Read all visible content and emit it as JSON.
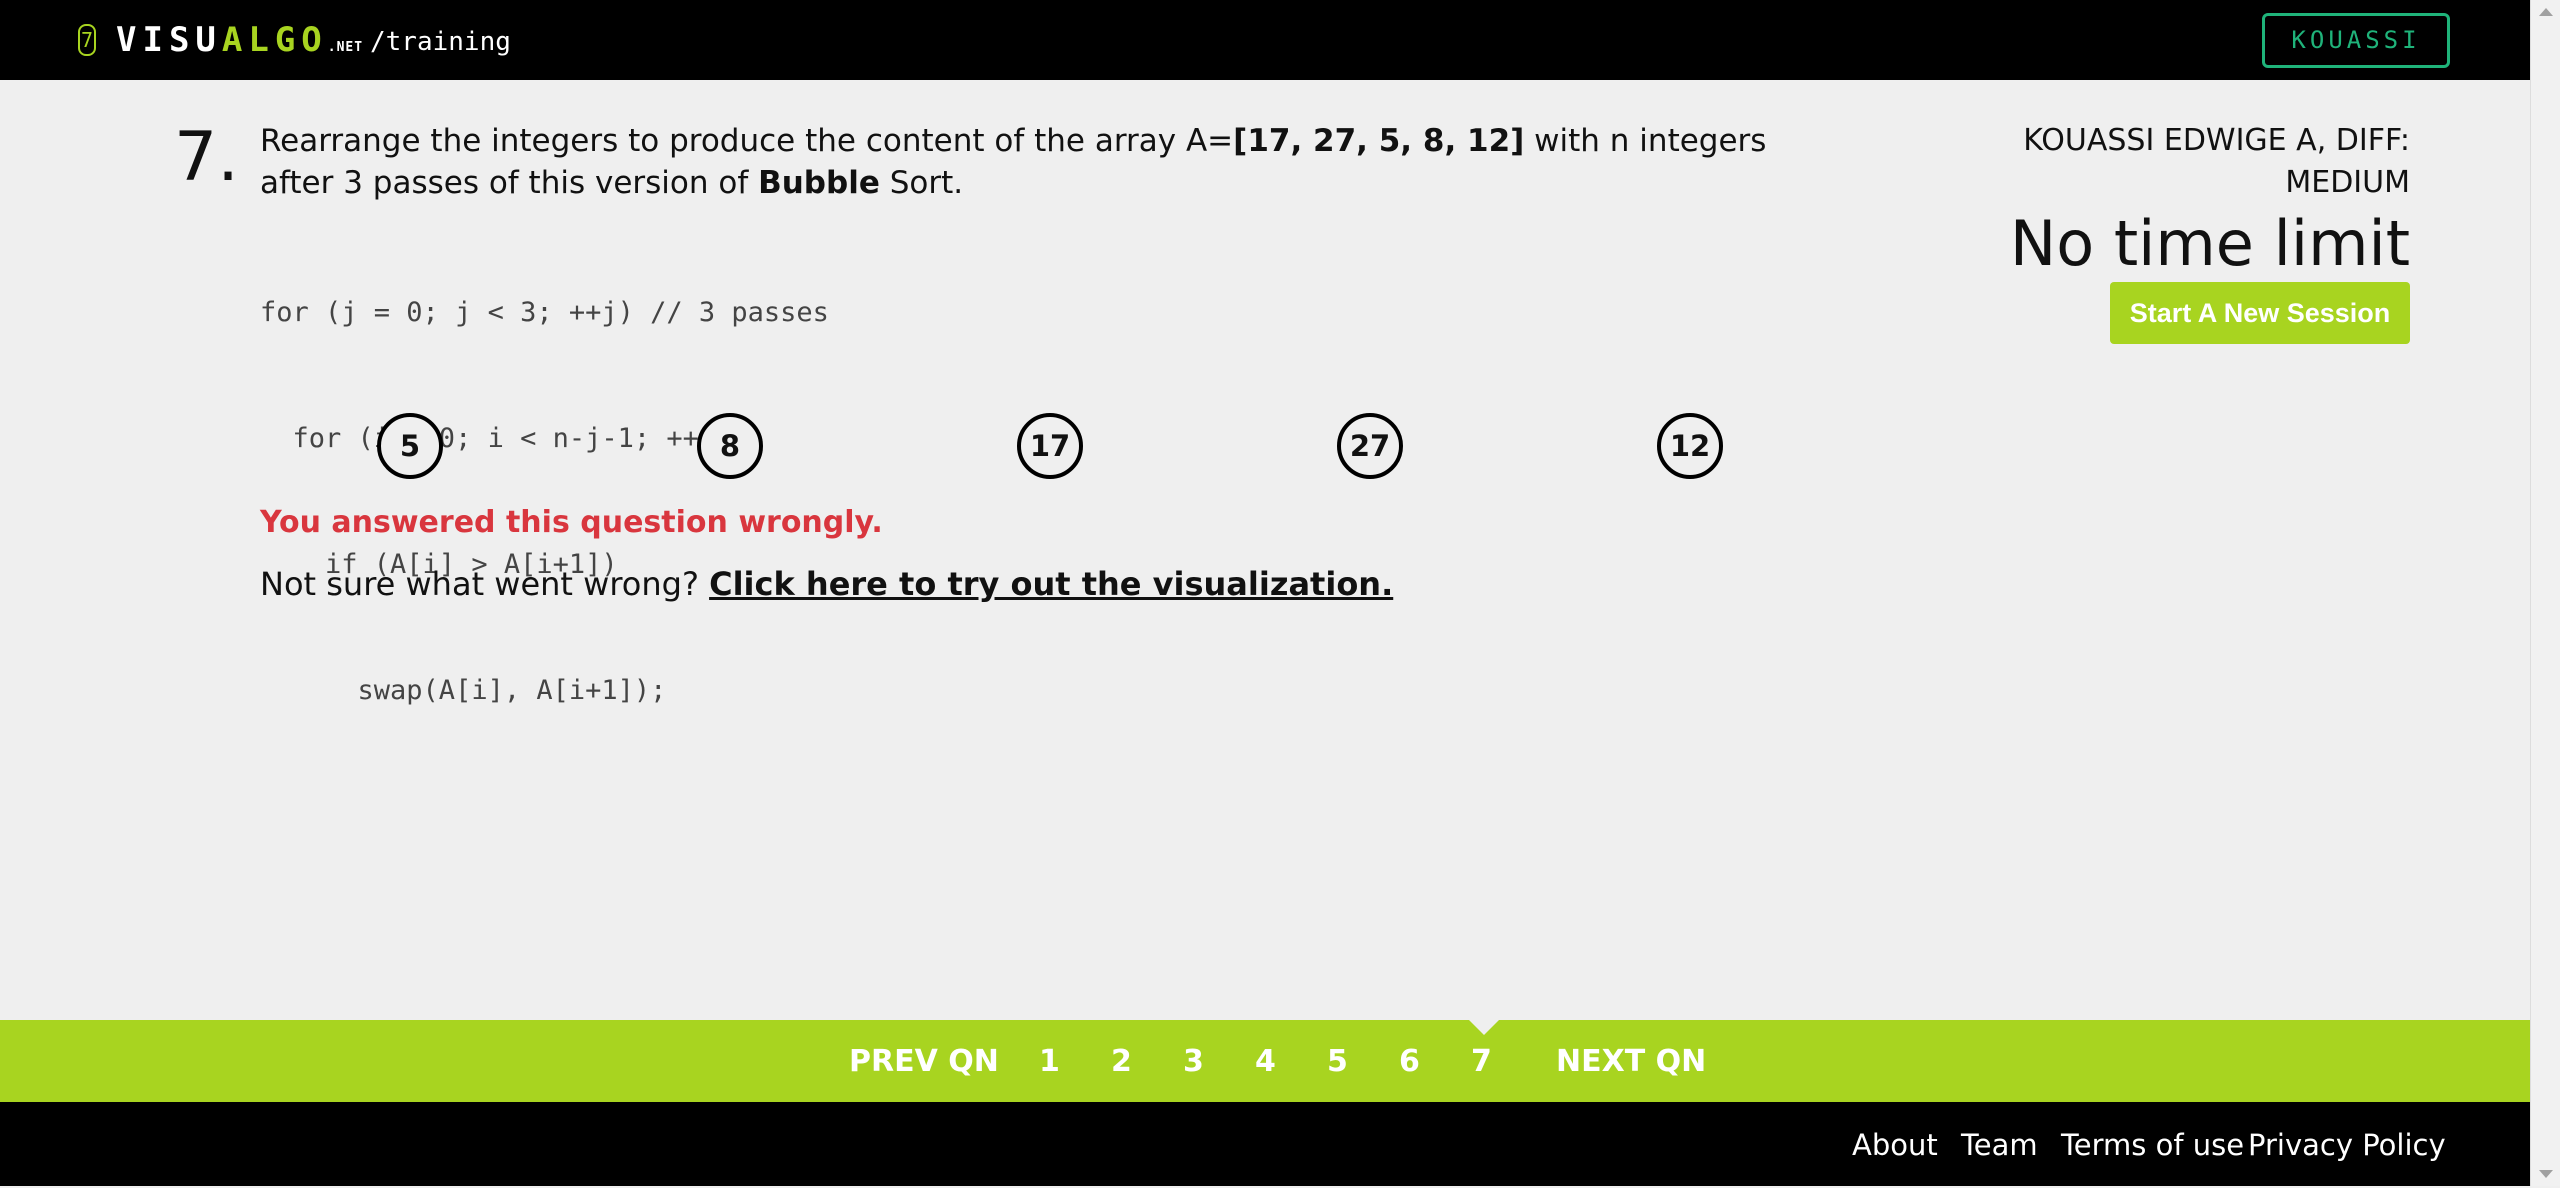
{
  "header": {
    "logo_mark": "7",
    "logo_visu": "VISU",
    "logo_algo": "ALGO",
    "logo_net": ".NET",
    "path": "/training",
    "user_button": "KOUASSI"
  },
  "question": {
    "number": "7.",
    "text_part1": "Rearrange the integers to produce the content of the array A=",
    "array": "[17, 27, 5, 8, 12]",
    "text_part2": " with n integers after 3 passes of this version of ",
    "algorithm": "Bubble",
    "text_part3": " Sort.",
    "code": [
      "for (j = 0; j < 3; ++j) // 3 passes",
      "  for (i = 0; i < n-j-1; ++i)",
      "    if (A[i] > A[i+1])",
      "      swap(A[i], A[i+1]);"
    ],
    "answer_nodes": [
      "5",
      "8",
      "17",
      "27",
      "12"
    ],
    "feedback": "You answered this question wrongly.",
    "hint_prefix": "Not sure what went wrong? ",
    "hint_link": "Click here to try out the visualization."
  },
  "info": {
    "user_line": "KOUASSI EDWIGE A, DIFF: MEDIUM",
    "time_limit": "No time limit",
    "new_session": "Start A New Session"
  },
  "nav": {
    "prev": "PREV QN",
    "questions": [
      "1",
      "2",
      "3",
      "4",
      "5",
      "6",
      "7"
    ],
    "current": "7",
    "next": "NEXT QN"
  },
  "footer": {
    "links": [
      "About",
      "Team",
      "Terms of use",
      "Privacy Policy"
    ]
  },
  "colors": {
    "accent_green": "#a8d420",
    "user_box": "#1fb37a",
    "error_red": "#d9363e",
    "background": "#efefef"
  }
}
